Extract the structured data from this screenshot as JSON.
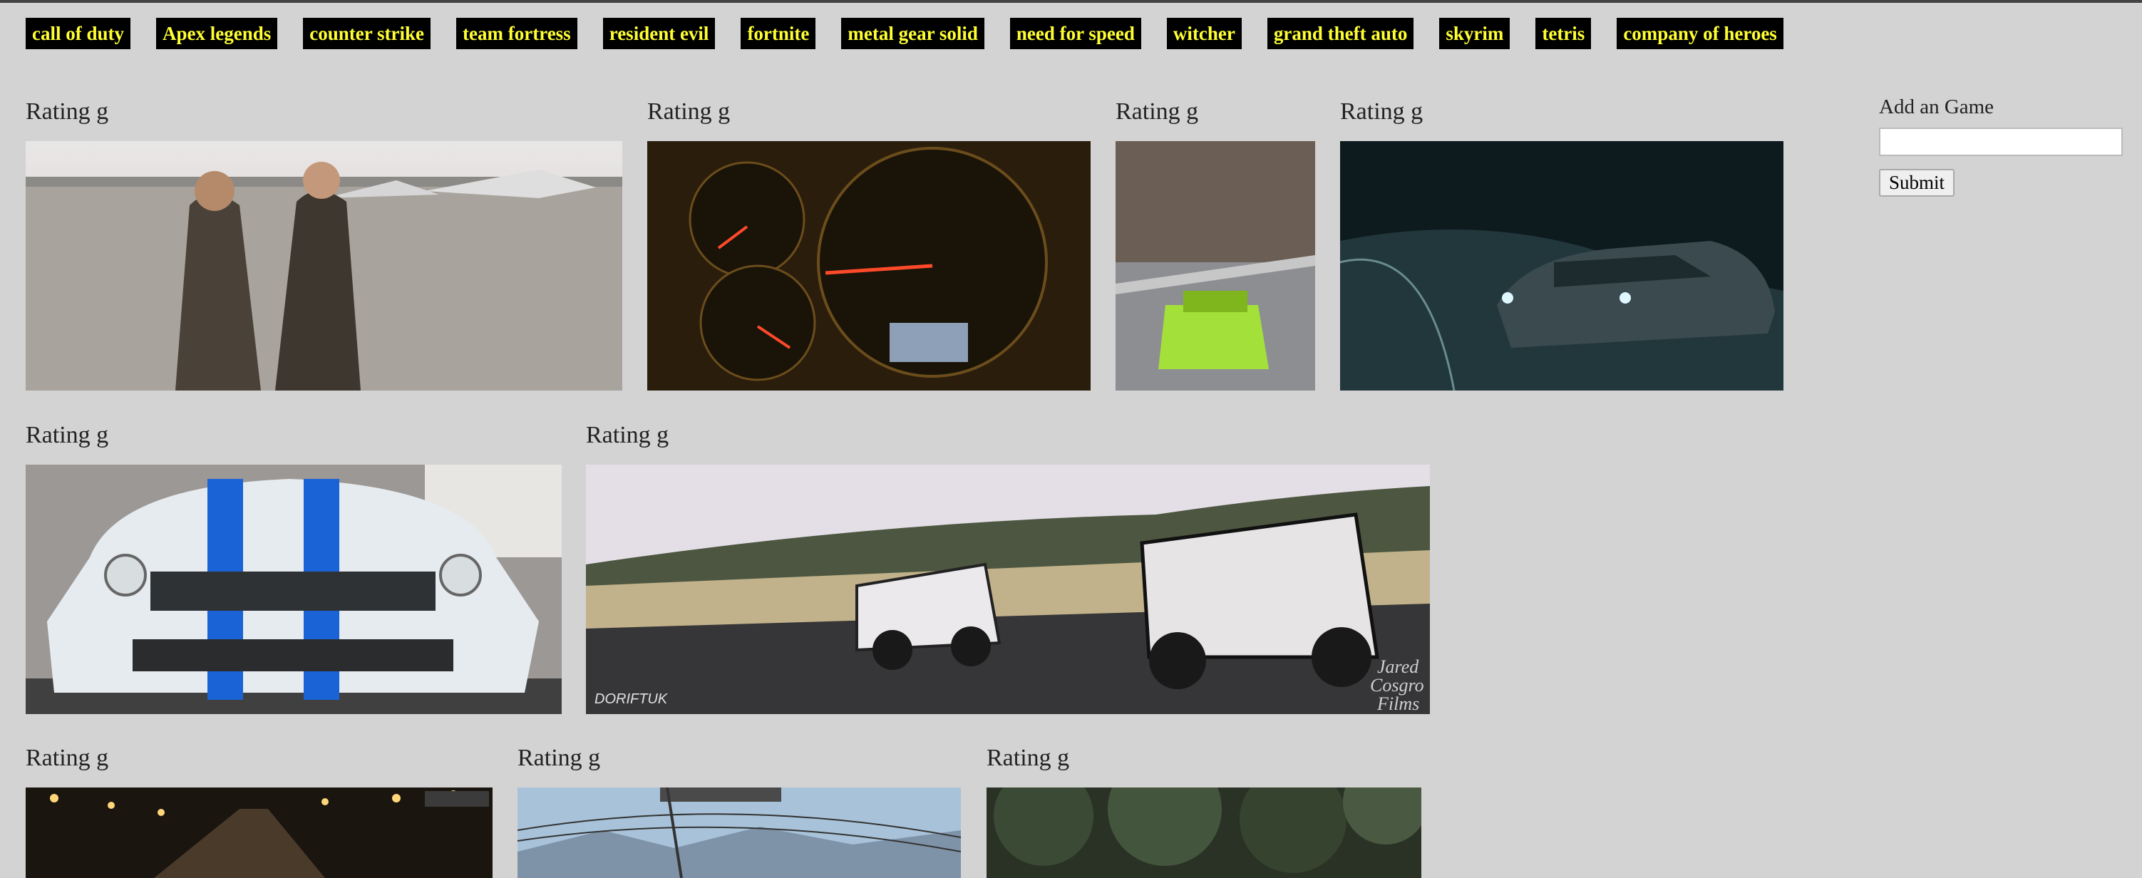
{
  "nav": {
    "games": [
      "call of duty",
      "Apex legends",
      "counter strike",
      "team fortress",
      "resident evil",
      "fortnite",
      "metal gear solid",
      "need for speed",
      "witcher",
      "grand theft auto",
      "skyrim",
      "tetris",
      "company of heroes"
    ]
  },
  "cards": [
    {
      "rating": "Rating g",
      "image": "pilots-walking-on-runway"
    },
    {
      "rating": "Rating g",
      "image": "speedometer-dashboard"
    },
    {
      "rating": "Rating g",
      "image": "green-car-racing-game"
    },
    {
      "rating": "Rating g",
      "image": "car-drifting-at-night"
    },
    {
      "rating": "Rating g",
      "image": "white-mustang-blue-stripes"
    },
    {
      "rating": "Rating g",
      "image": "two-cars-drifting"
    },
    {
      "rating": "Rating g",
      "image": "night-street-lights"
    },
    {
      "rating": "Rating g",
      "image": "mountain-power-lines"
    },
    {
      "rating": "Rating g",
      "image": "dark-trees"
    }
  ],
  "form": {
    "label": "Add an Game",
    "input_value": "",
    "submit_label": "Submit"
  },
  "watermarks": {
    "dorifto": "DORIFTUK",
    "jared_line1": "Jared",
    "jared_line2": "Cosgro",
    "jared_line3": "Films"
  }
}
